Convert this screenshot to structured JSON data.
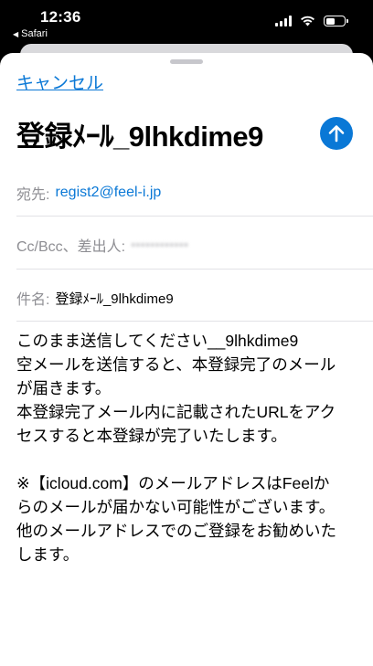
{
  "status_bar": {
    "time": "12:36",
    "back_app": "Safari"
  },
  "sheet": {
    "cancel_label": "キャンセル",
    "subject_title": "登録ﾒｰﾙ_9lhkdime9",
    "to_label": "宛先:",
    "to_value": "regist2@feel-i.jp",
    "ccbcc_label": "Cc/Bcc、差出人:",
    "ccbcc_value": "••••••••••••",
    "subject_label": "件名:",
    "subject_value": "登録ﾒｰﾙ_9lhkdime9"
  },
  "body": {
    "line1": "このまま送信してください__9lhkdime9",
    "line2": "空メールを送信すると、本登録完了のメール",
    "line3": "が届きます。",
    "line4": "本登録完了メール内に記載されたURLをアク",
    "line5": "セスすると本登録が完了いたします。",
    "line6": "※【icloud.com】のメールアドレスはFeelか",
    "line7": "らのメールが届かない可能性がございます。",
    "line8": "他のメールアドレスでのご登録をお勧めいた",
    "line9": "します。"
  },
  "colors": {
    "accent": "#0a78d6",
    "label_gray": "#8e8e93"
  }
}
